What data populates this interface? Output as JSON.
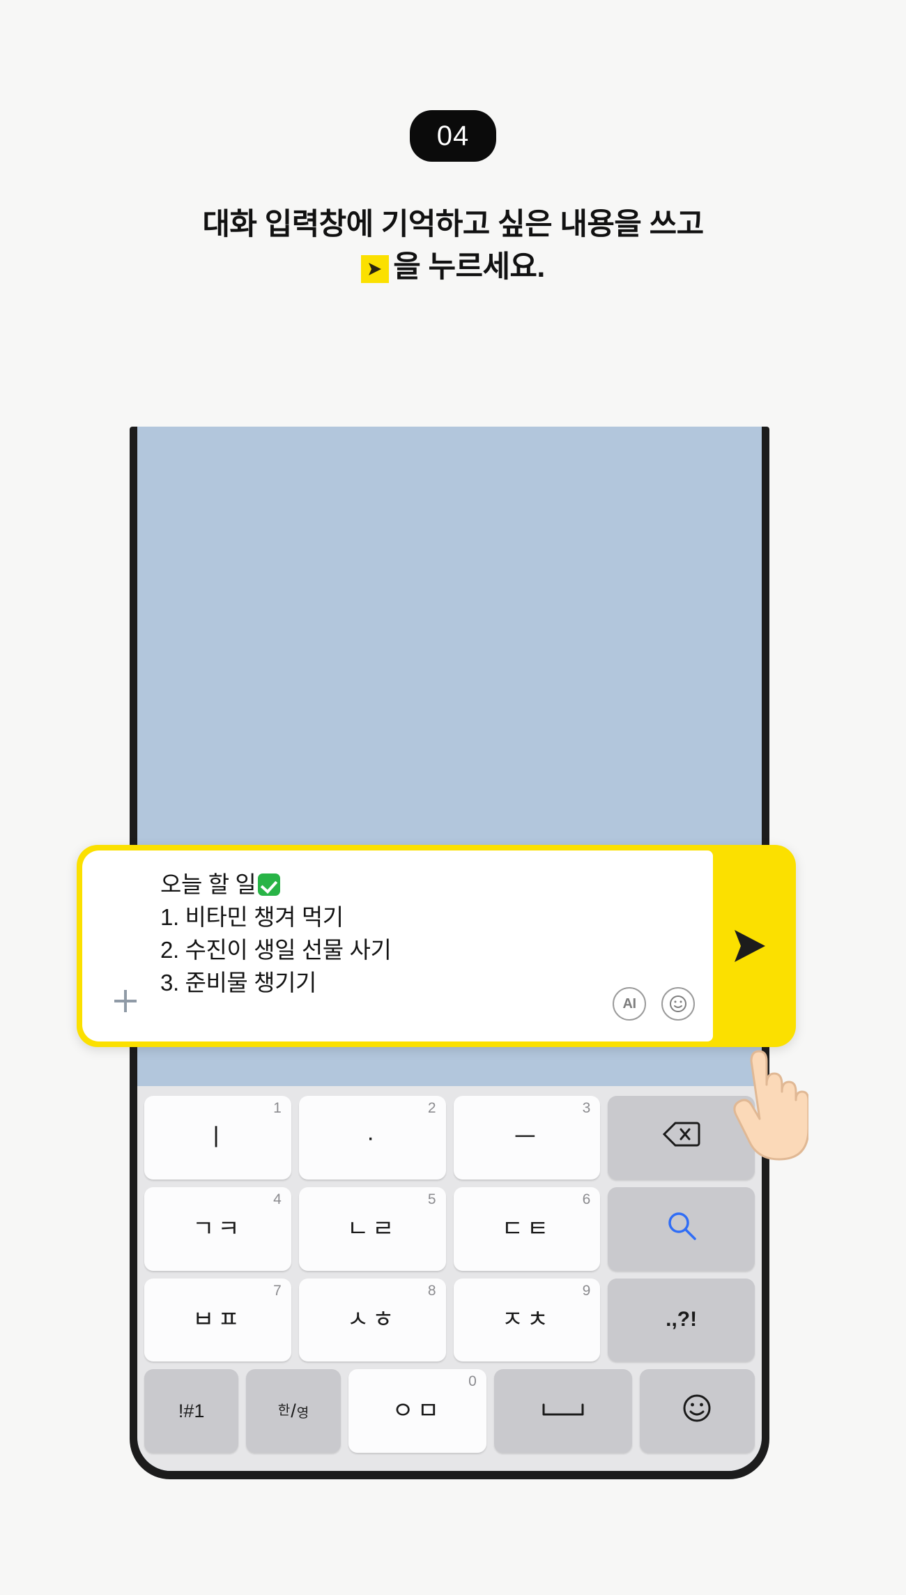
{
  "step": {
    "number": "04"
  },
  "heading": {
    "line1": "대화 입력창에 기억하고 싶은 내용을 쓰고",
    "line2_before": "",
    "line2_after": "을 누르세요.",
    "inline_icon": "send-icon"
  },
  "phone": {
    "chat_background_color": "#b2c6dc",
    "bezel_color": "#1c1c1c"
  },
  "input_bubble": {
    "accent_color": "#fbe000",
    "plus_icon": "plus-icon",
    "message_lines": [
      "오늘 할 일",
      "1. 비타민 챙겨 먹기",
      "2. 수진이 생일 선물 사기",
      "3. 준비물 챙기기"
    ],
    "emoji_after_first_line": "white-check-mark",
    "actions": [
      {
        "name": "ai-button",
        "label": "AI"
      },
      {
        "name": "emoji-button",
        "label": "☺"
      }
    ],
    "send_label": "send-icon"
  },
  "keyboard": {
    "rows": [
      [
        {
          "name": "key-i",
          "glyph": "ㅣ",
          "num": "1",
          "type": "char"
        },
        {
          "name": "key-dot",
          "glyph": "·",
          "num": "2",
          "type": "char"
        },
        {
          "name": "key-eu",
          "glyph": "ㅡ",
          "num": "3",
          "type": "char"
        },
        {
          "name": "key-backspace",
          "glyph": "",
          "num": "",
          "type": "backspace"
        }
      ],
      [
        {
          "name": "key-giyeok-kieuk",
          "glyph": "ㄱㅋ",
          "num": "4",
          "type": "char"
        },
        {
          "name": "key-nieun-rieul",
          "glyph": "ㄴㄹ",
          "num": "5",
          "type": "char"
        },
        {
          "name": "key-digeut-tieut",
          "glyph": "ㄷㅌ",
          "num": "6",
          "type": "char"
        },
        {
          "name": "key-search",
          "glyph": "",
          "num": "",
          "type": "search"
        }
      ],
      [
        {
          "name": "key-bieup-pieup",
          "glyph": "ㅂㅍ",
          "num": "7",
          "type": "char"
        },
        {
          "name": "key-siot-hieut",
          "glyph": "ㅅㅎ",
          "num": "8",
          "type": "char"
        },
        {
          "name": "key-jieut-chieut",
          "glyph": "ㅈㅊ",
          "num": "9",
          "type": "char"
        },
        {
          "name": "key-punctuation",
          "glyph": ".,?!",
          "num": "",
          "type": "sym"
        }
      ],
      [
        {
          "name": "key-symbols",
          "glyph": "!#1",
          "num": "",
          "type": "sym-fn"
        },
        {
          "name": "key-lang-toggle",
          "glyph": "한/영",
          "num": "",
          "type": "hanyeong"
        },
        {
          "name": "key-ieung-mieum",
          "glyph": "ㅇㅁ",
          "num": "0",
          "type": "char"
        },
        {
          "name": "key-space",
          "glyph": "␣",
          "num": "",
          "type": "space"
        },
        {
          "name": "key-emoji",
          "glyph": "☺",
          "num": "",
          "type": "emoji"
        }
      ]
    ]
  }
}
